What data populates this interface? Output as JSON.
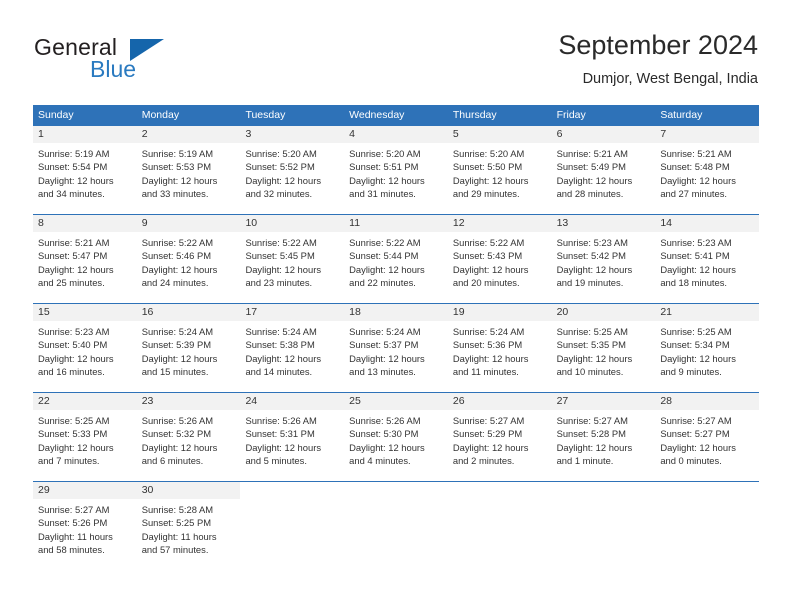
{
  "brand": {
    "name_top": "General",
    "name_bottom": "Blue",
    "triangle_icon": "triangle-icon",
    "accent_color": "#2a7ac0"
  },
  "header": {
    "month_title": "September 2024",
    "location": "Dumjor, West Bengal, India"
  },
  "theme": {
    "header_blue": "#2e72b8",
    "date_band_gray": "#f2f2f2",
    "text": "#333333"
  },
  "calendar": {
    "weekdays": [
      "Sunday",
      "Monday",
      "Tuesday",
      "Wednesday",
      "Thursday",
      "Friday",
      "Saturday"
    ],
    "weeks": [
      [
        {
          "date": "1",
          "lines": [
            "Sunrise: 5:19 AM",
            "Sunset: 5:54 PM",
            "Daylight: 12 hours",
            "and 34 minutes."
          ]
        },
        {
          "date": "2",
          "lines": [
            "Sunrise: 5:19 AM",
            "Sunset: 5:53 PM",
            "Daylight: 12 hours",
            "and 33 minutes."
          ]
        },
        {
          "date": "3",
          "lines": [
            "Sunrise: 5:20 AM",
            "Sunset: 5:52 PM",
            "Daylight: 12 hours",
            "and 32 minutes."
          ]
        },
        {
          "date": "4",
          "lines": [
            "Sunrise: 5:20 AM",
            "Sunset: 5:51 PM",
            "Daylight: 12 hours",
            "and 31 minutes."
          ]
        },
        {
          "date": "5",
          "lines": [
            "Sunrise: 5:20 AM",
            "Sunset: 5:50 PM",
            "Daylight: 12 hours",
            "and 29 minutes."
          ]
        },
        {
          "date": "6",
          "lines": [
            "Sunrise: 5:21 AM",
            "Sunset: 5:49 PM",
            "Daylight: 12 hours",
            "and 28 minutes."
          ]
        },
        {
          "date": "7",
          "lines": [
            "Sunrise: 5:21 AM",
            "Sunset: 5:48 PM",
            "Daylight: 12 hours",
            "and 27 minutes."
          ]
        }
      ],
      [
        {
          "date": "8",
          "lines": [
            "Sunrise: 5:21 AM",
            "Sunset: 5:47 PM",
            "Daylight: 12 hours",
            "and 25 minutes."
          ]
        },
        {
          "date": "9",
          "lines": [
            "Sunrise: 5:22 AM",
            "Sunset: 5:46 PM",
            "Daylight: 12 hours",
            "and 24 minutes."
          ]
        },
        {
          "date": "10",
          "lines": [
            "Sunrise: 5:22 AM",
            "Sunset: 5:45 PM",
            "Daylight: 12 hours",
            "and 23 minutes."
          ]
        },
        {
          "date": "11",
          "lines": [
            "Sunrise: 5:22 AM",
            "Sunset: 5:44 PM",
            "Daylight: 12 hours",
            "and 22 minutes."
          ]
        },
        {
          "date": "12",
          "lines": [
            "Sunrise: 5:22 AM",
            "Sunset: 5:43 PM",
            "Daylight: 12 hours",
            "and 20 minutes."
          ]
        },
        {
          "date": "13",
          "lines": [
            "Sunrise: 5:23 AM",
            "Sunset: 5:42 PM",
            "Daylight: 12 hours",
            "and 19 minutes."
          ]
        },
        {
          "date": "14",
          "lines": [
            "Sunrise: 5:23 AM",
            "Sunset: 5:41 PM",
            "Daylight: 12 hours",
            "and 18 minutes."
          ]
        }
      ],
      [
        {
          "date": "15",
          "lines": [
            "Sunrise: 5:23 AM",
            "Sunset: 5:40 PM",
            "Daylight: 12 hours",
            "and 16 minutes."
          ]
        },
        {
          "date": "16",
          "lines": [
            "Sunrise: 5:24 AM",
            "Sunset: 5:39 PM",
            "Daylight: 12 hours",
            "and 15 minutes."
          ]
        },
        {
          "date": "17",
          "lines": [
            "Sunrise: 5:24 AM",
            "Sunset: 5:38 PM",
            "Daylight: 12 hours",
            "and 14 minutes."
          ]
        },
        {
          "date": "18",
          "lines": [
            "Sunrise: 5:24 AM",
            "Sunset: 5:37 PM",
            "Daylight: 12 hours",
            "and 13 minutes."
          ]
        },
        {
          "date": "19",
          "lines": [
            "Sunrise: 5:24 AM",
            "Sunset: 5:36 PM",
            "Daylight: 12 hours",
            "and 11 minutes."
          ]
        },
        {
          "date": "20",
          "lines": [
            "Sunrise: 5:25 AM",
            "Sunset: 5:35 PM",
            "Daylight: 12 hours",
            "and 10 minutes."
          ]
        },
        {
          "date": "21",
          "lines": [
            "Sunrise: 5:25 AM",
            "Sunset: 5:34 PM",
            "Daylight: 12 hours",
            "and 9 minutes."
          ]
        }
      ],
      [
        {
          "date": "22",
          "lines": [
            "Sunrise: 5:25 AM",
            "Sunset: 5:33 PM",
            "Daylight: 12 hours",
            "and 7 minutes."
          ]
        },
        {
          "date": "23",
          "lines": [
            "Sunrise: 5:26 AM",
            "Sunset: 5:32 PM",
            "Daylight: 12 hours",
            "and 6 minutes."
          ]
        },
        {
          "date": "24",
          "lines": [
            "Sunrise: 5:26 AM",
            "Sunset: 5:31 PM",
            "Daylight: 12 hours",
            "and 5 minutes."
          ]
        },
        {
          "date": "25",
          "lines": [
            "Sunrise: 5:26 AM",
            "Sunset: 5:30 PM",
            "Daylight: 12 hours",
            "and 4 minutes."
          ]
        },
        {
          "date": "26",
          "lines": [
            "Sunrise: 5:27 AM",
            "Sunset: 5:29 PM",
            "Daylight: 12 hours",
            "and 2 minutes."
          ]
        },
        {
          "date": "27",
          "lines": [
            "Sunrise: 5:27 AM",
            "Sunset: 5:28 PM",
            "Daylight: 12 hours",
            "and 1 minute."
          ]
        },
        {
          "date": "28",
          "lines": [
            "Sunrise: 5:27 AM",
            "Sunset: 5:27 PM",
            "Daylight: 12 hours",
            "and 0 minutes."
          ]
        }
      ],
      [
        {
          "date": "29",
          "lines": [
            "Sunrise: 5:27 AM",
            "Sunset: 5:26 PM",
            "Daylight: 11 hours",
            "and 58 minutes."
          ]
        },
        {
          "date": "30",
          "lines": [
            "Sunrise: 5:28 AM",
            "Sunset: 5:25 PM",
            "Daylight: 11 hours",
            "and 57 minutes."
          ]
        },
        {
          "date": "",
          "lines": []
        },
        {
          "date": "",
          "lines": []
        },
        {
          "date": "",
          "lines": []
        },
        {
          "date": "",
          "lines": []
        },
        {
          "date": "",
          "lines": []
        }
      ]
    ]
  }
}
